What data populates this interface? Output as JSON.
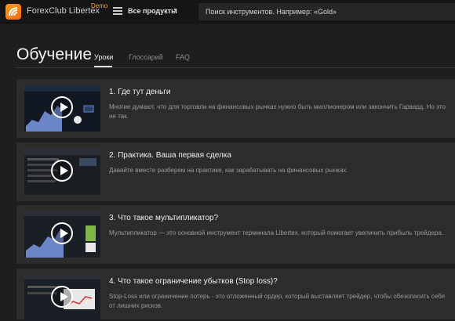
{
  "header": {
    "brand": "ForexClub Libertex",
    "demo_badge": "Demo",
    "menu_icon": "hamburger-icon",
    "products_label": "Все продукты",
    "search_placeholder": "Поиск инструментов. Например: «Gold»"
  },
  "page": {
    "title": "Обучение",
    "tabs": [
      {
        "label": "Уроки",
        "active": true
      },
      {
        "label": "Глоссарий",
        "active": false
      },
      {
        "label": "FAQ",
        "active": false
      }
    ]
  },
  "lessons": [
    {
      "title": "1. Где тут деньги",
      "description": "Многие думают, что для торговли на финансовых рынках нужно быть миллионером или закончить Гарвард. Но это не так."
    },
    {
      "title": "2. Практика. Ваша первая сделка",
      "description": "Давайте вместе разберем на практике, как зарабатывать на финансовых рынках."
    },
    {
      "title": "3. Что такое мультипликатор?",
      "description": "Мультипликатор — это основной инструмент терминала Libertex, который помогает увеличить прибыль трейдера."
    },
    {
      "title": "4. Что такое ограничение убытков (Stop loss)?",
      "description": "Stop-Loss или ограничение потерь - это отложенный ордер, который выставляет трейдер, чтобы обезопасить себя от лишних рисков."
    }
  ],
  "colors": {
    "accent": "#f5a623",
    "background": "#1e1e1e",
    "card": "#2c2c2c"
  }
}
